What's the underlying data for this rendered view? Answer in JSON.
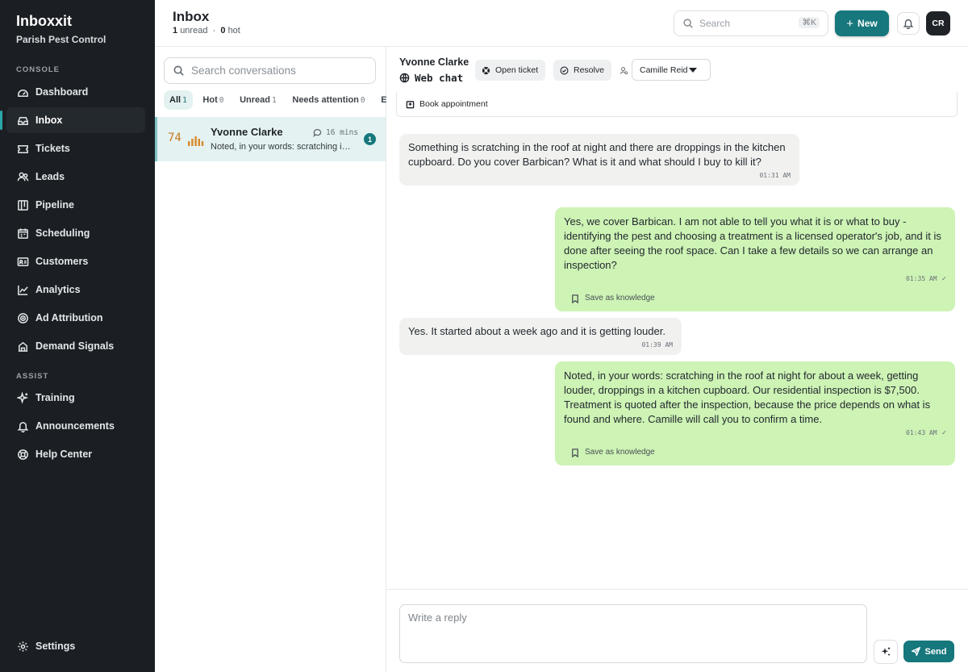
{
  "app": {
    "brand": "Inboxxit",
    "org": "Parish Pest Control"
  },
  "sidebar": {
    "console_label": "CONSOLE",
    "assist_label": "ASSIST",
    "console_items": [
      {
        "label": "Dashboard",
        "icon": "dashboard-icon"
      },
      {
        "label": "Inbox",
        "icon": "inbox-icon",
        "active": true
      },
      {
        "label": "Tickets",
        "icon": "ticket-icon"
      },
      {
        "label": "Leads",
        "icon": "users-icon"
      },
      {
        "label": "Pipeline",
        "icon": "pipeline-icon"
      },
      {
        "label": "Scheduling",
        "icon": "calendar-icon"
      },
      {
        "label": "Customers",
        "icon": "id-card-icon"
      },
      {
        "label": "Analytics",
        "icon": "chart-icon"
      },
      {
        "label": "Ad Attribution",
        "icon": "target-icon"
      },
      {
        "label": "Demand Signals",
        "icon": "building-icon"
      }
    ],
    "assist_items": [
      {
        "label": "Training",
        "icon": "sparkle-icon"
      },
      {
        "label": "Announcements",
        "icon": "bell-icon"
      },
      {
        "label": "Help Center",
        "icon": "lifebuoy-icon"
      }
    ],
    "settings_label": "Settings"
  },
  "header": {
    "title": "Inbox",
    "unread_count": "1",
    "unread_label": "unread",
    "separator": "·",
    "hot_count": "0",
    "hot_label": "hot",
    "search_placeholder": "Search",
    "search_shortcut": "⌘K",
    "new_label": "New",
    "user_initials": "CR"
  },
  "list": {
    "search_placeholder": "Search conversations",
    "filters": [
      {
        "label": "All",
        "count": "1",
        "active": true
      },
      {
        "label": "Hot",
        "count": "0"
      },
      {
        "label": "Unread",
        "count": "1"
      },
      {
        "label": "Needs attention",
        "count": "0"
      },
      {
        "label": "Ex",
        "count": ""
      }
    ],
    "conversations": [
      {
        "score": "74",
        "name": "Yvonne Clarke",
        "time": "16 mins",
        "preview": "Noted, in your words: scratching in the roof at night for about a week",
        "unread": "1"
      }
    ]
  },
  "chat": {
    "contact_name": "Yvonne Clarke",
    "channel": "Web chat",
    "open_ticket_label": "Open ticket",
    "resolve_label": "Resolve",
    "assignee": "Camille Reid",
    "book_label": "Book appointment",
    "messages": [
      {
        "dir": "in",
        "text": "Something is scratching in the roof at night and there are droppings in the kitchen cupboard. Do you cover Barbican? What is it and what should I buy to kill it?",
        "time": "01:31 AM"
      },
      {
        "dir": "out",
        "text": "Yes, we cover Barbican. I am not able to tell you what it is or what to buy - identifying the pest and choosing a treatment is a licensed operator's job, and it is done after seeing the roof space. Can I take a few details so we can arrange an inspection?",
        "time": "01:35 AM",
        "save_label": "Save as knowledge"
      },
      {
        "dir": "in",
        "text": "Yes. It started about a week ago and it is getting louder.",
        "time": "01:39 AM"
      },
      {
        "dir": "out",
        "text": "Noted, in your words: scratching in the roof at night for about a week, getting louder, droppings in a kitchen cupboard. Our residential inspection is $7,500. Treatment is quoted after the inspection, because the price depends on what is found and where. Camille will call you to confirm a time.",
        "time": "01:43 AM",
        "save_label": "Save as knowledge"
      }
    ],
    "reply_placeholder": "Write a reply",
    "send_label": "Send"
  },
  "colors": {
    "accent": "#16777c",
    "sidebar_bg": "#1b1f23",
    "outgoing_bubble": "#cdf3b5",
    "incoming_bubble": "#f1f1f0",
    "score": "#c97a1c"
  }
}
